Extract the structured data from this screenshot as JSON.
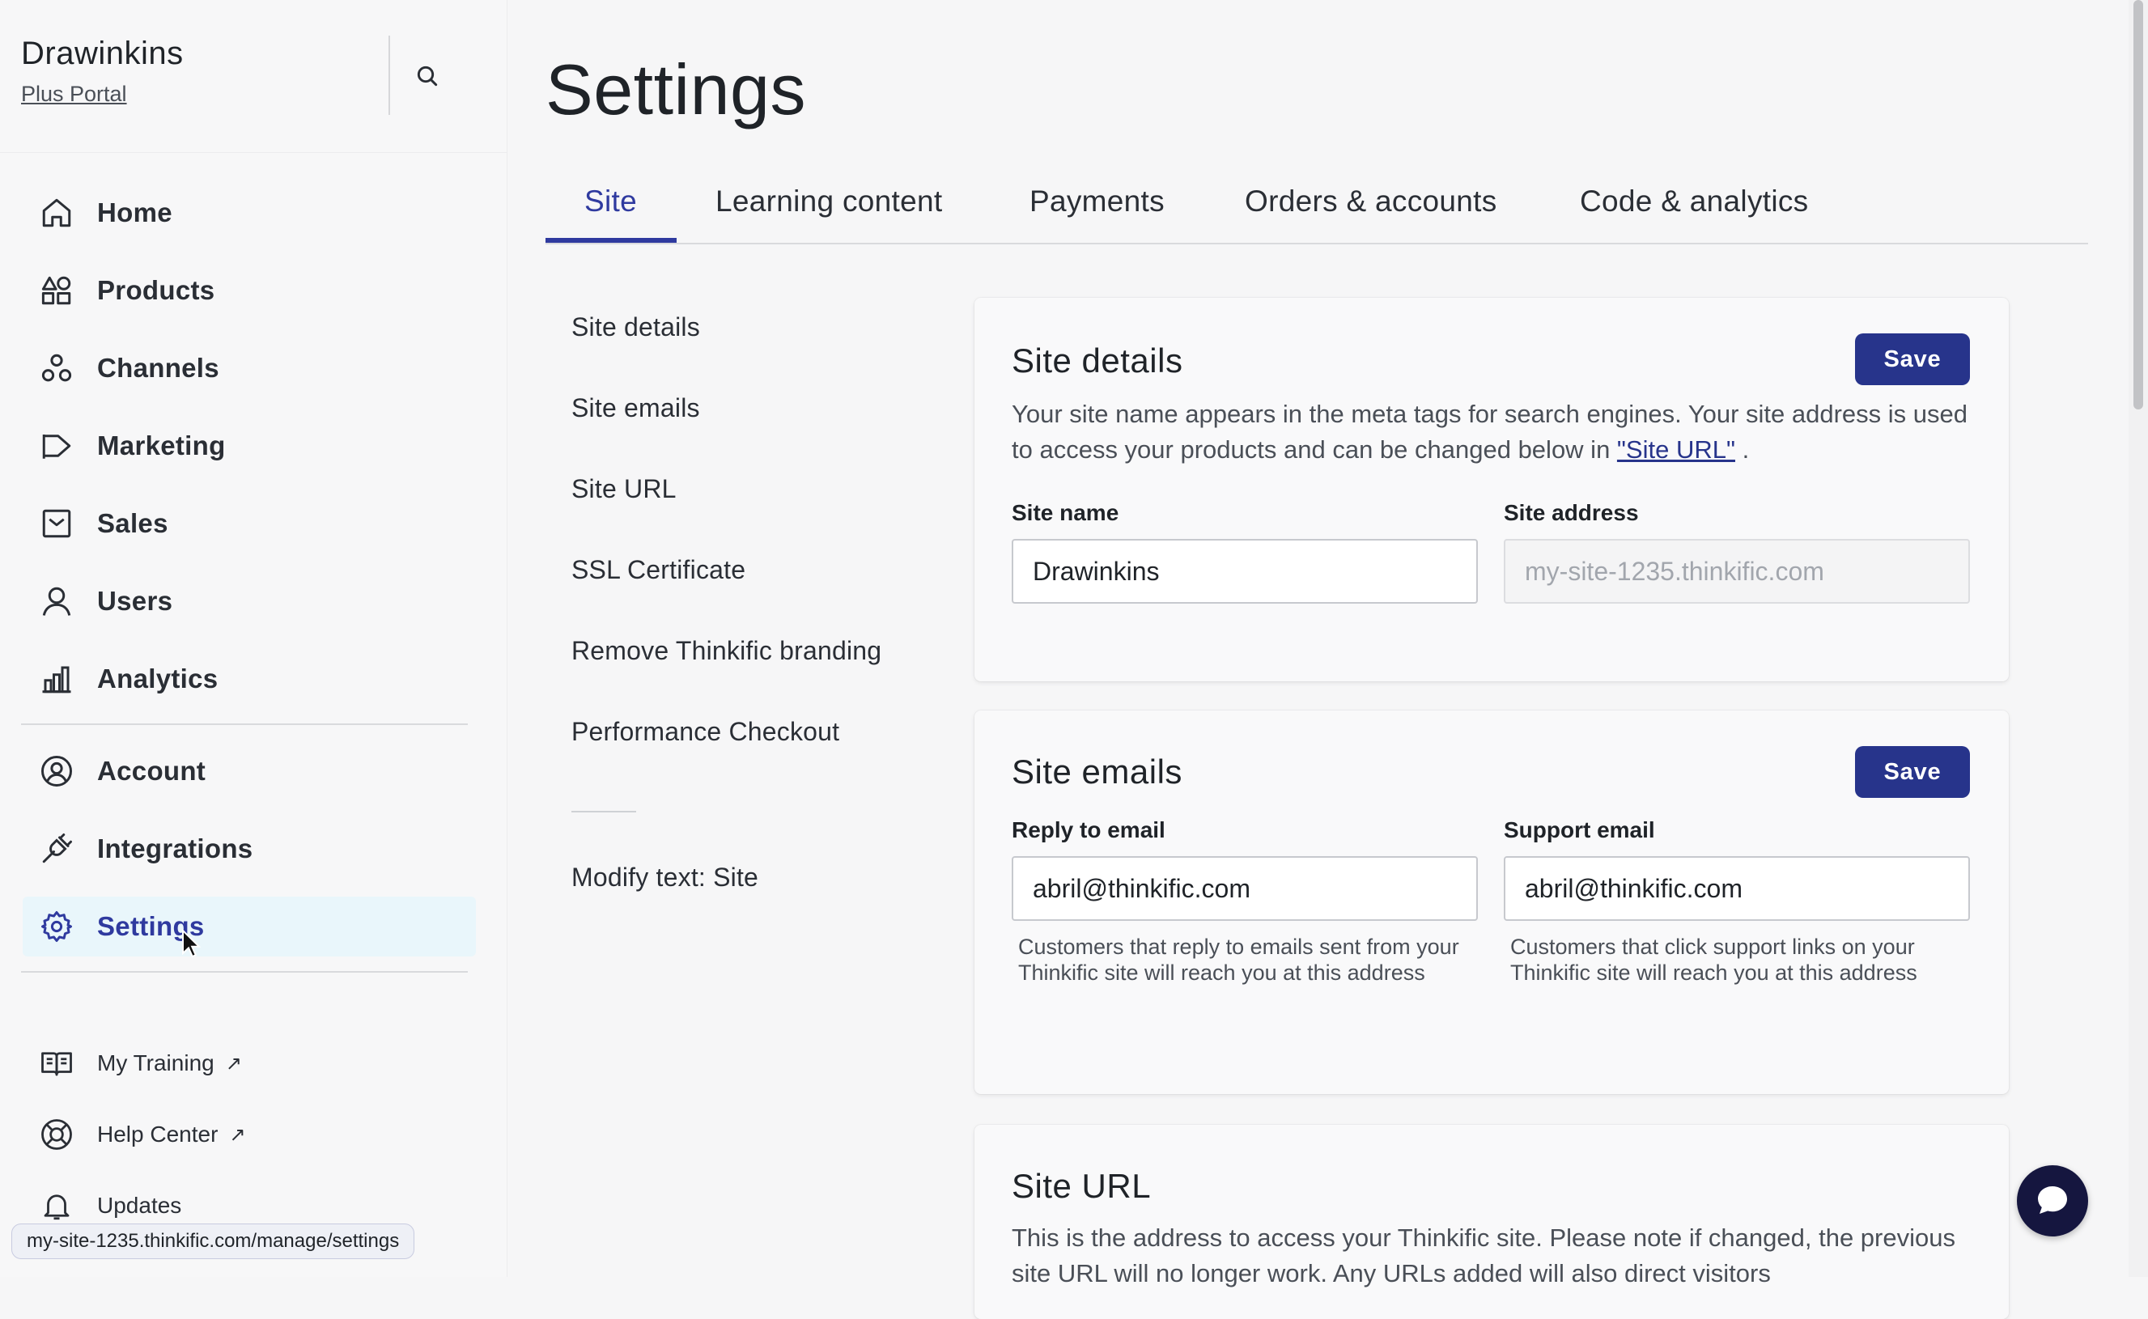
{
  "sidebar": {
    "brand_name": "Drawinkins",
    "brand_sub": "Plus Portal",
    "nav_items": [
      {
        "label": "Home",
        "icon": "home-icon"
      },
      {
        "label": "Products",
        "icon": "shapes-icon"
      },
      {
        "label": "Channels",
        "icon": "channels-icon"
      },
      {
        "label": "Marketing",
        "icon": "megaphone-icon"
      },
      {
        "label": "Sales",
        "icon": "sales-icon"
      },
      {
        "label": "Users",
        "icon": "user-icon"
      },
      {
        "label": "Analytics",
        "icon": "bar-chart-icon"
      }
    ],
    "secondary_items": [
      {
        "label": "Account",
        "icon": "account-icon"
      },
      {
        "label": "Integrations",
        "icon": "plug-icon"
      },
      {
        "label": "Settings",
        "icon": "gear-icon",
        "active": true
      }
    ],
    "resource_items": [
      {
        "label": "My Training",
        "icon": "book-icon",
        "external": "↗"
      },
      {
        "label": "Help Center",
        "icon": "lifebuoy-icon",
        "external": "↗"
      },
      {
        "label": "Updates",
        "icon": "bell-icon"
      }
    ]
  },
  "status_url": "my-site-1235.thinkific.com/manage/settings",
  "page": {
    "title": "Settings",
    "tabs": [
      "Site",
      "Learning content",
      "Payments",
      "Orders & accounts",
      "Code & analytics"
    ],
    "active_tab": "Site"
  },
  "subnav": {
    "items": [
      "Site details",
      "Site emails",
      "Site URL",
      "SSL Certificate",
      "Remove Thinkific branding",
      "Performance Checkout"
    ],
    "modify_text": "Modify text: Site"
  },
  "site_details": {
    "title": "Site details",
    "save_label": "Save",
    "desc_before": "Your site name appears in the meta tags for search engines. Your site address is used to access your products and can be changed below in ",
    "desc_link": "\"Site URL\"",
    "desc_after": " .",
    "site_name_label": "Site name",
    "site_name_value": "Drawinkins",
    "site_address_label": "Site address",
    "site_address_placeholder": "my-site-1235.thinkific.com"
  },
  "site_emails": {
    "title": "Site emails",
    "save_label": "Save",
    "reply_label": "Reply to email",
    "reply_value": "abril@thinkific.com",
    "reply_help": "Customers that reply to emails sent from your Thinkific site will reach you at this address",
    "support_label": "Support email",
    "support_value": "abril@thinkific.com",
    "support_help": "Customers that click support links on your Thinkific site will reach you at this address"
  },
  "site_url": {
    "title": "Site URL",
    "desc": "This is the address to access your Thinkific site. Please note if changed, the previous site URL will no longer work. Any URLs added will also direct visitors"
  },
  "colors": {
    "accent": "#2f3a9f",
    "button": "#27348b",
    "chat": "#15163f"
  }
}
